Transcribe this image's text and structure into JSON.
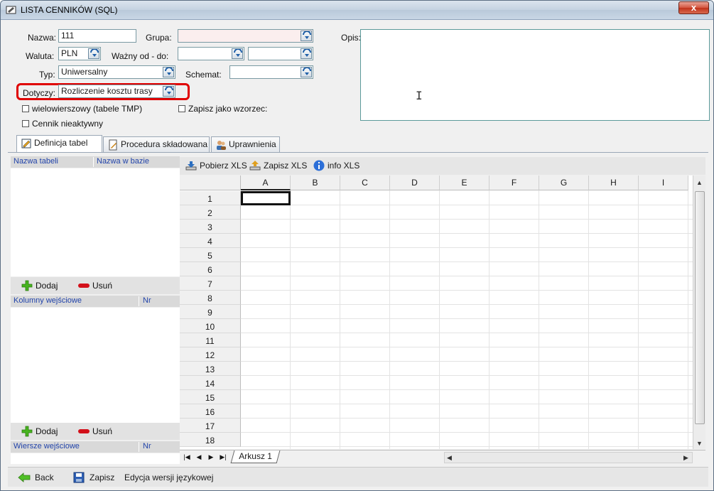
{
  "window": {
    "title": "LISTA CENNIKÓW (SQL)",
    "close_label": "x"
  },
  "form": {
    "nazwa_label": "Nazwa:",
    "nazwa_value": "111",
    "grupa_label": "Grupa:",
    "grupa_value": "",
    "opis_label": "Opis:",
    "opis_value": "",
    "waluta_label": "Waluta:",
    "waluta_value": "PLN",
    "wazny_label": "Ważny od - do:",
    "wazny_od_value": "",
    "wazny_do_value": "",
    "typ_label": "Typ:",
    "typ_value": "Uniwersalny",
    "schemat_label": "Schemat:",
    "schemat_value": "",
    "dotyczy_label": "Dotyczy:",
    "dotyczy_value": "Rozliczenie kosztu trasy",
    "wielowierszowy_label": "wielowierszowy (tabele TMP)",
    "zapisz_wzorzec_label": "Zapisz jako wzorzec:",
    "nieaktywny_label": "Cennik nieaktywny"
  },
  "tabs": [
    {
      "label": "Definicja tabel",
      "icon": "edit-icon",
      "active": true
    },
    {
      "label": "Procedura składowana",
      "icon": "document-edit-icon",
      "active": false
    },
    {
      "label": "Uprawnienia",
      "icon": "users-icon",
      "active": false
    }
  ],
  "panels": {
    "tables_header": {
      "col1": "Nazwa tabeli",
      "col2": "Nazwa w bazie"
    },
    "add_label": "Dodaj",
    "remove_label": "Usuń",
    "input_columns_header": {
      "col1": "Kolumny wejściowe",
      "col2": "Nr"
    },
    "input_rows_header": {
      "col1": "Wiersze wejściowe",
      "col2": "Nr"
    }
  },
  "sheet_toolbar": {
    "download_label": "Pobierz XLS",
    "save_label": "Zapisz XLS",
    "info_label": "info XLS"
  },
  "sheet": {
    "columns": [
      "A",
      "B",
      "C",
      "D",
      "E",
      "F",
      "G",
      "H",
      "I"
    ],
    "rows": [
      "1",
      "2",
      "3",
      "4",
      "5",
      "6",
      "7",
      "8",
      "9",
      "10",
      "11",
      "12",
      "13",
      "14",
      "15",
      "16",
      "17",
      "18"
    ],
    "selected_cell": "A1",
    "tab_label": "Arkusz 1"
  },
  "bottom": {
    "back_label": "Back",
    "save_label": "Zapisz",
    "lang_label": "Edycja wersji językowej"
  },
  "colors": {
    "highlight": "#e00000",
    "accent": "#2244aa"
  }
}
